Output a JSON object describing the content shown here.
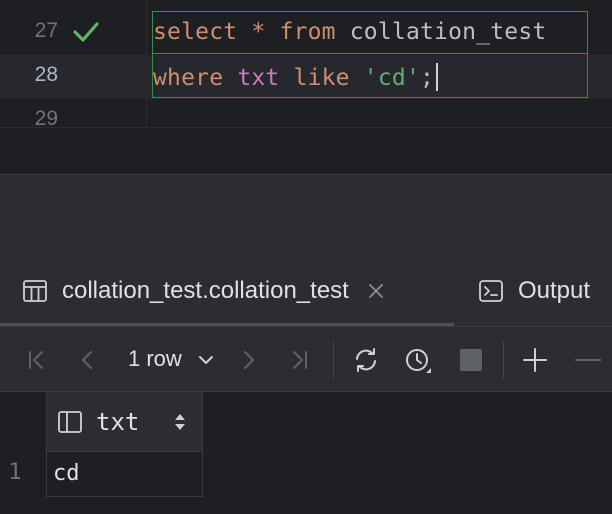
{
  "editor": {
    "lines": [
      {
        "number": "27",
        "status": "check-icon"
      },
      {
        "number": "28"
      },
      {
        "number": "29"
      }
    ],
    "code_line_1": {
      "kw_select": "select",
      "star": "*",
      "kw_from": "from",
      "table": "collation_test"
    },
    "code_line_2": {
      "kw_where": "where",
      "col": "txt",
      "kw_like": "like",
      "literal": "'cd'",
      "semicolon": ";"
    }
  },
  "panel": {
    "tabs": [
      {
        "label": "collation_test.collation_test",
        "icon": "table-icon",
        "closable": true
      },
      {
        "label": "Output",
        "icon": "console-icon"
      }
    ],
    "toolbar": {
      "rows_label": "1 row",
      "buttons": [
        "first-page-icon",
        "prev-page-icon",
        "next-page-icon",
        "last-page-icon",
        "refresh-icon",
        "history-icon",
        "stop-icon",
        "add-row-icon",
        "remove-row-icon"
      ]
    },
    "grid": {
      "columns": [
        {
          "name": "txt",
          "icon": "column-icon"
        }
      ],
      "rows": [
        {
          "number": "1",
          "values": [
            "cd"
          ]
        }
      ]
    }
  },
  "colors": {
    "keyword": "#cf8e6d",
    "identifier": "#c77dbb",
    "string": "#6aab73",
    "check": "#5fb865",
    "statement_outline": "#3d8a4d"
  }
}
